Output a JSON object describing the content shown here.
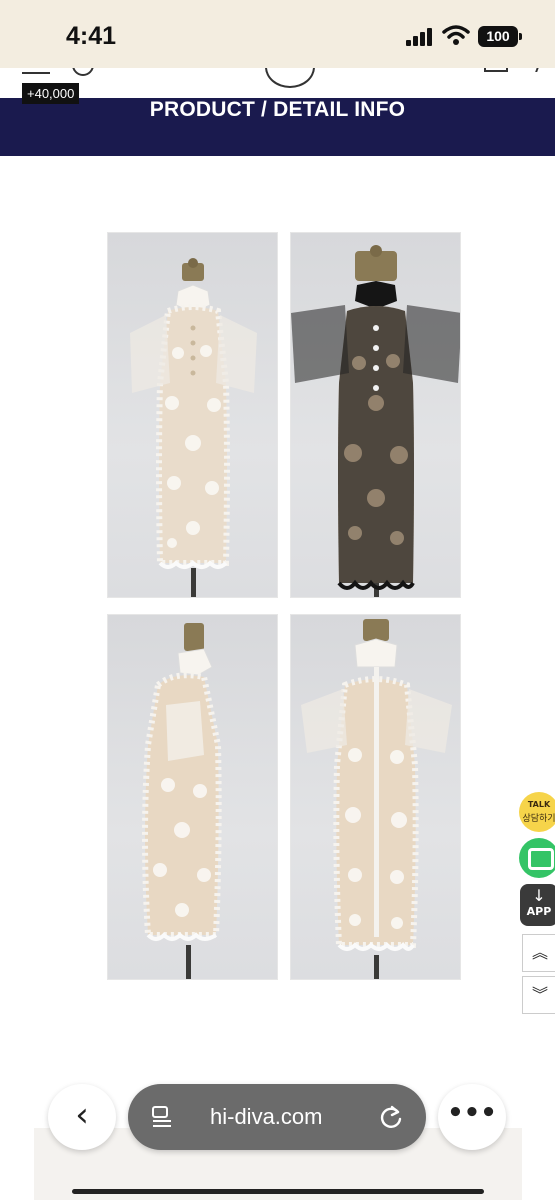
{
  "status_bar": {
    "time": "4:41",
    "battery": "100"
  },
  "header": {
    "price_badge": "+40,000",
    "title": "PRODUCT / DETAIL INFO"
  },
  "product_photos": [
    {
      "view": "front",
      "dress_color": "#f4efe6",
      "lining_color": "#e8d7c2",
      "name": "photo-white-front"
    },
    {
      "view": "front",
      "dress_color": "#1c1c1c",
      "lining_color": "#cdb49a",
      "name": "photo-black-front"
    },
    {
      "view": "side",
      "dress_color": "#f4efe6",
      "lining_color": "#e8d7c2",
      "name": "photo-white-side"
    },
    {
      "view": "back",
      "dress_color": "#f4efe6",
      "lining_color": "#e8d7c2",
      "name": "photo-white-back"
    }
  ],
  "floating": {
    "talk_top": "TALK",
    "talk_label": "상담하기",
    "app_label": "APP",
    "app_arrow": "↓",
    "scroll_up": "︽",
    "scroll_down": "︾"
  },
  "browser": {
    "back": "‹",
    "url": "hi-diva.com",
    "more": "•••"
  },
  "colors": {
    "status_bar_bg": "#f3ede0",
    "title_band": "#1a1a4e",
    "talk": "#f6d44a",
    "chat": "#34c466"
  }
}
